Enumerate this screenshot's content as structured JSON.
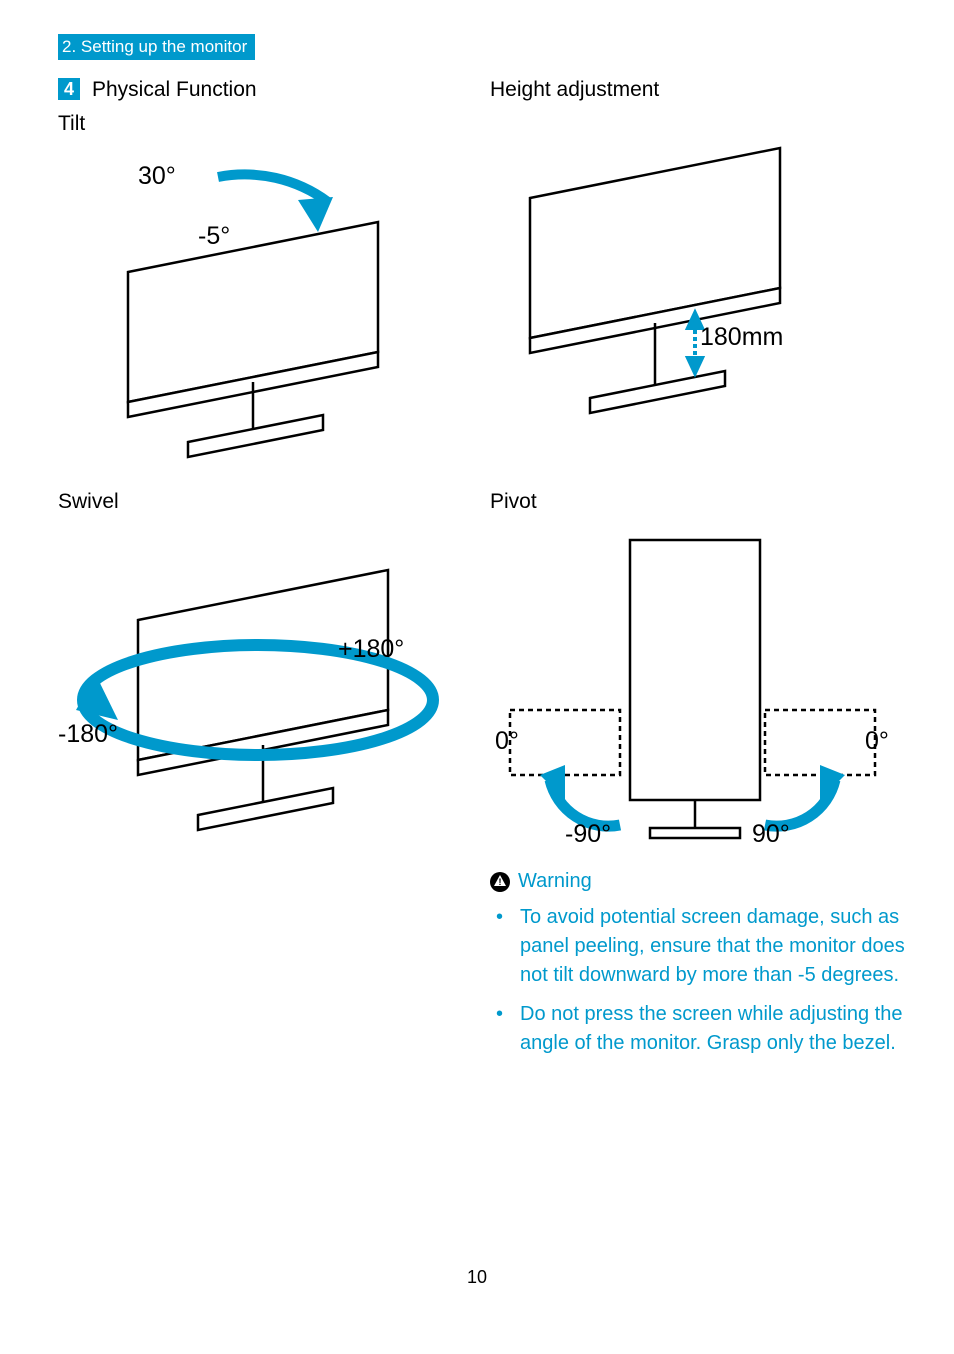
{
  "header": "2. Setting up the monitor",
  "section": {
    "num": "4",
    "title": "Physical Function"
  },
  "tilt": {
    "heading": "Tilt",
    "up": "30°",
    "down": "-5°"
  },
  "swivel": {
    "heading": "Swivel",
    "left": "-180°",
    "right": "+180°"
  },
  "height": {
    "heading": "Height adjustment",
    "value": "180mm"
  },
  "pivot": {
    "heading": "Pivot",
    "zero_l": "0°",
    "zero_r": "0°",
    "neg90": "-90°",
    "pos90": "90°"
  },
  "warning": {
    "title": "Warning",
    "items": [
      "To avoid potential screen damage, such as panel peeling, ensure that the monitor does not tilt downward by more than -5 degrees.",
      "Do not press the screen while adjusting the angle of the monitor. Grasp only the bezel."
    ]
  },
  "page": "10"
}
